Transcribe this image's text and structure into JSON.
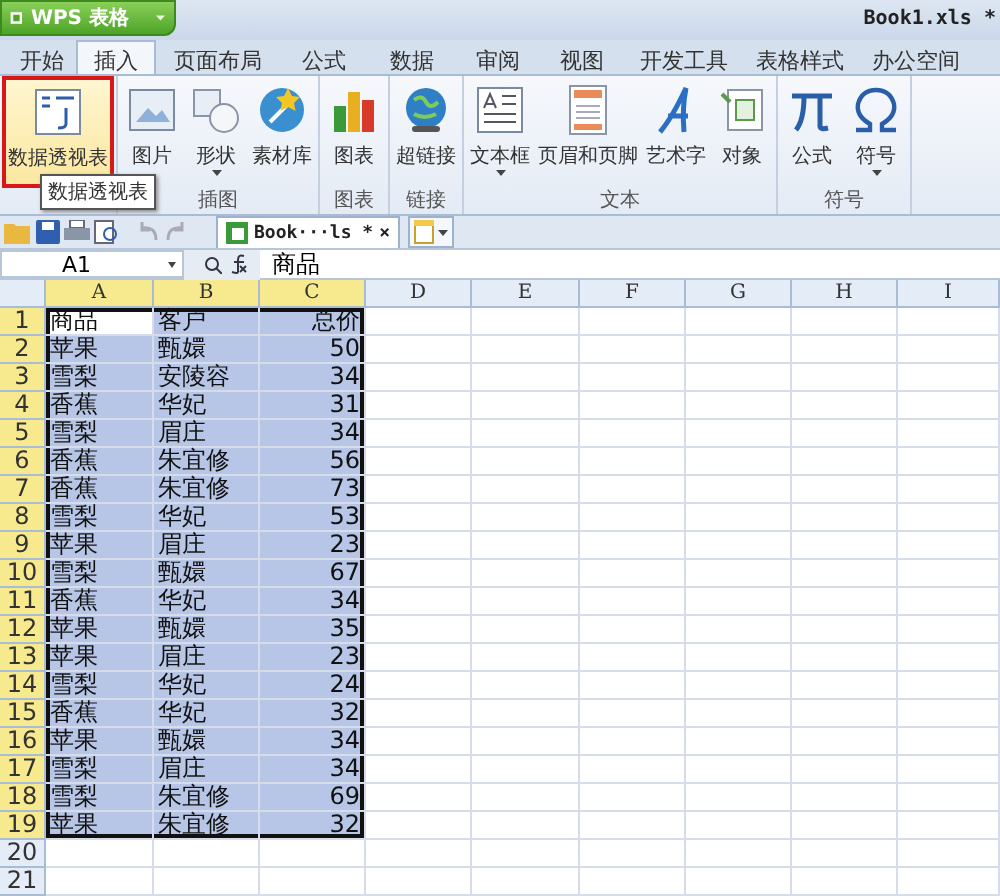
{
  "window": {
    "app_button": "WPS 表格",
    "title": "Book1.xls *"
  },
  "tabs": [
    {
      "label": "开始",
      "selected": false
    },
    {
      "label": "插入",
      "selected": true
    },
    {
      "label": "页面布局",
      "selected": false
    },
    {
      "label": "公式",
      "selected": false
    },
    {
      "label": "数据",
      "selected": false
    },
    {
      "label": "审阅",
      "selected": false
    },
    {
      "label": "视图",
      "selected": false
    },
    {
      "label": "开发工具",
      "selected": false
    },
    {
      "label": "表格样式",
      "selected": false
    },
    {
      "label": "办公空间",
      "selected": false
    }
  ],
  "ribbon": {
    "groups": [
      {
        "items": [
          {
            "label": "数据透视表",
            "dropdown": false,
            "highlighted": true
          }
        ]
      },
      {
        "label": "插图",
        "items": [
          {
            "label": "图片",
            "dropdown": false,
            "highlighted": false
          },
          {
            "label": "形状",
            "dropdown": true,
            "highlighted": false
          },
          {
            "label": "素材库",
            "dropdown": false,
            "highlighted": false
          }
        ]
      },
      {
        "label": "图表",
        "items": [
          {
            "label": "图表",
            "dropdown": false,
            "highlighted": false
          }
        ]
      },
      {
        "label": "链接",
        "items": [
          {
            "label": "超链接",
            "dropdown": false,
            "highlighted": false
          }
        ]
      },
      {
        "label": "文本",
        "items": [
          {
            "label": "文本框",
            "dropdown": true,
            "highlighted": false
          },
          {
            "label": "页眉和页脚",
            "dropdown": false,
            "highlighted": false
          },
          {
            "label": "艺术字",
            "dropdown": false,
            "highlighted": false
          },
          {
            "label": "对象",
            "dropdown": false,
            "highlighted": false
          }
        ]
      },
      {
        "label": "符号",
        "items": [
          {
            "label": "公式",
            "dropdown": false,
            "highlighted": false
          },
          {
            "label": "符号",
            "dropdown": true,
            "highlighted": false
          }
        ]
      }
    ],
    "tooltip": "数据透视表"
  },
  "document_tab": {
    "label": "Book···ls *",
    "close": "×"
  },
  "formula_bar": {
    "name_box": "A1",
    "value": "商品"
  },
  "sheet": {
    "columns": [
      {
        "label": "A",
        "selected": true,
        "kind": "text"
      },
      {
        "label": "B",
        "selected": true,
        "kind": "text"
      },
      {
        "label": "C",
        "selected": true,
        "kind": "number"
      },
      {
        "label": "D",
        "selected": false,
        "kind": "text"
      },
      {
        "label": "E",
        "selected": false,
        "kind": "text"
      },
      {
        "label": "F",
        "selected": false,
        "kind": "text"
      },
      {
        "label": "G",
        "selected": false,
        "kind": "text"
      },
      {
        "label": "H",
        "selected": false,
        "kind": "text"
      },
      {
        "label": "I",
        "selected": false,
        "kind": "text"
      }
    ],
    "rows": [
      {
        "header": "1",
        "selected": true,
        "active": true,
        "cells": [
          "商品",
          "客户",
          "总价"
        ]
      },
      {
        "header": "2",
        "selected": true,
        "active": false,
        "cells": [
          "苹果",
          "甄嬛",
          "50"
        ]
      },
      {
        "header": "3",
        "selected": true,
        "active": false,
        "cells": [
          "雪梨",
          "安陵容",
          "34"
        ]
      },
      {
        "header": "4",
        "selected": true,
        "active": false,
        "cells": [
          "香蕉",
          "华妃",
          "31"
        ]
      },
      {
        "header": "5",
        "selected": true,
        "active": false,
        "cells": [
          "雪梨",
          "眉庄",
          "34"
        ]
      },
      {
        "header": "6",
        "selected": true,
        "active": false,
        "cells": [
          "香蕉",
          "朱宜修",
          "56"
        ]
      },
      {
        "header": "7",
        "selected": true,
        "active": false,
        "cells": [
          "香蕉",
          "朱宜修",
          "73"
        ]
      },
      {
        "header": "8",
        "selected": true,
        "active": false,
        "cells": [
          "雪梨",
          "华妃",
          "53"
        ]
      },
      {
        "header": "9",
        "selected": true,
        "active": false,
        "cells": [
          "苹果",
          "眉庄",
          "23"
        ]
      },
      {
        "header": "10",
        "selected": true,
        "active": false,
        "cells": [
          "雪梨",
          "甄嬛",
          "67"
        ]
      },
      {
        "header": "11",
        "selected": true,
        "active": false,
        "cells": [
          "香蕉",
          "华妃",
          "34"
        ]
      },
      {
        "header": "12",
        "selected": true,
        "active": false,
        "cells": [
          "苹果",
          "甄嬛",
          "35"
        ]
      },
      {
        "header": "13",
        "selected": true,
        "active": false,
        "cells": [
          "苹果",
          "眉庄",
          "23"
        ]
      },
      {
        "header": "14",
        "selected": true,
        "active": false,
        "cells": [
          "雪梨",
          "华妃",
          "24"
        ]
      },
      {
        "header": "15",
        "selected": true,
        "active": false,
        "cells": [
          "香蕉",
          "华妃",
          "32"
        ]
      },
      {
        "header": "16",
        "selected": true,
        "active": false,
        "cells": [
          "苹果",
          "甄嬛",
          "34"
        ]
      },
      {
        "header": "17",
        "selected": true,
        "active": false,
        "cells": [
          "雪梨",
          "眉庄",
          "34"
        ]
      },
      {
        "header": "18",
        "selected": true,
        "active": false,
        "cells": [
          "雪梨",
          "朱宜修",
          "69"
        ]
      },
      {
        "header": "19",
        "selected": true,
        "active": false,
        "cells": [
          "苹果",
          "朱宜修",
          "32"
        ]
      },
      {
        "header": "20",
        "selected": false
      },
      {
        "header": "21",
        "selected": false
      }
    ]
  }
}
